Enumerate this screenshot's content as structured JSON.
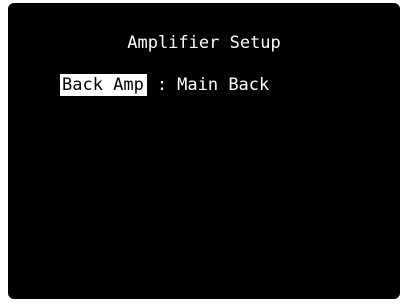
{
  "screen": {
    "title": "Amplifier Setup",
    "background_color": "#000000",
    "text_color": "#ffffff",
    "highlight_color": "#ffffff",
    "setting": {
      "label": "Back Amp",
      "separator": ":",
      "value": "Main Back"
    }
  }
}
